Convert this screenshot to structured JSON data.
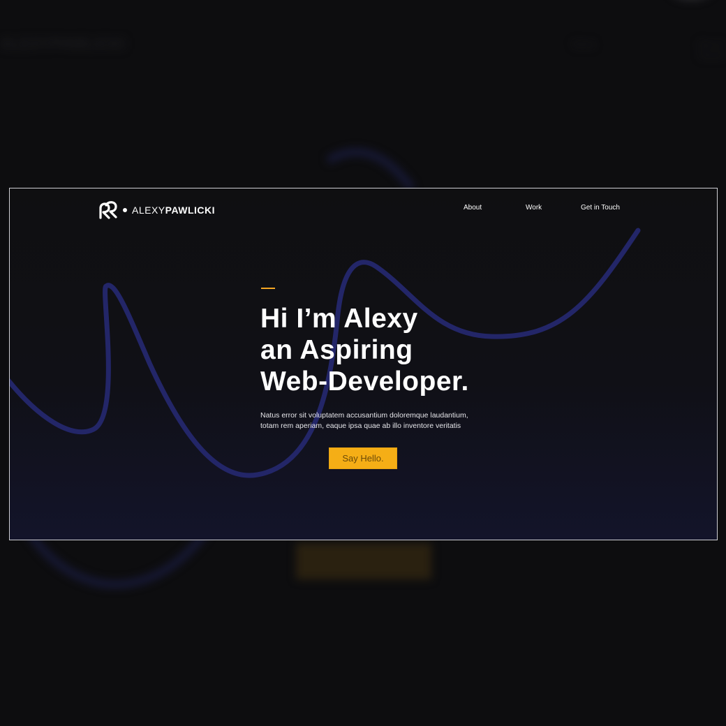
{
  "brand": {
    "logo_icon": "ap-monogram-icon",
    "name_light": "ALEXY",
    "name_bold": "PAWLICKI"
  },
  "nav": {
    "items": [
      {
        "label": "About"
      },
      {
        "label": "Work"
      },
      {
        "label": "Get in Touch"
      }
    ]
  },
  "hero": {
    "lines": [
      "Hi I’m Alexy",
      "an Aspiring",
      "Web-Developer"
    ],
    "final_punctuation": ".",
    "description_lines": [
      "Natus error sit voluptatem accusantium doloremque laudantium,",
      "totam rem aperiam, eaque ipsa quae ab illo inventore veritatis"
    ],
    "cta_label": "Say Hello."
  },
  "colors": {
    "background": "#0d0d0f",
    "accent": "#f5ae16",
    "wave": "#232668",
    "text": "#ffffff"
  }
}
